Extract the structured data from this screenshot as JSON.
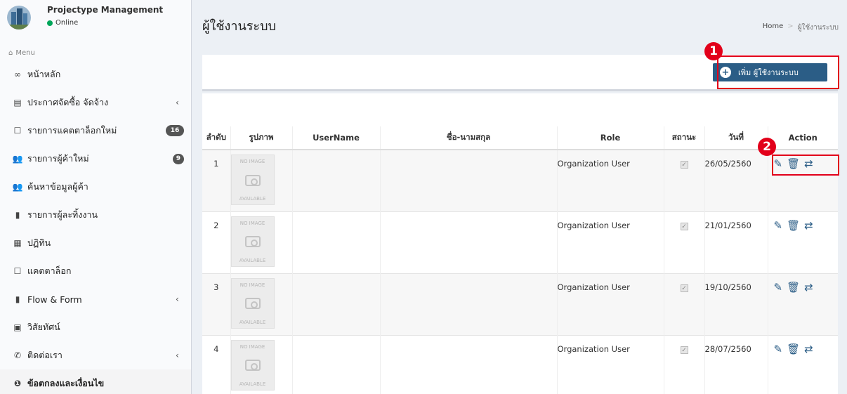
{
  "app": {
    "name": "Projectype Management",
    "status": "Online"
  },
  "sidebar": {
    "header": "Menu",
    "items": [
      {
        "icon": "link-icon",
        "glyph": "∞",
        "label": "หน้าหลัก"
      },
      {
        "icon": "newspaper-icon",
        "glyph": "▤",
        "label": "ประกาศจัดซื้อ จัดจ้าง",
        "chevron": "‹"
      },
      {
        "icon": "square-icon",
        "glyph": "☐",
        "label": "รายการแคตตาล็อกใหม่",
        "badge": "16"
      },
      {
        "icon": "users-icon",
        "glyph": "👥",
        "label": "รายการผู้ค้าใหม่",
        "badge": "9"
      },
      {
        "icon": "users-icon",
        "glyph": "👥",
        "label": "ค้นหาข้อมูลผู้ค้า"
      },
      {
        "icon": "file-icon",
        "glyph": "▮",
        "label": "รายการผู้ละทิ้งงาน"
      },
      {
        "icon": "calendar-icon",
        "glyph": "▦",
        "label": "ปฏิทิน"
      },
      {
        "icon": "square-icon",
        "glyph": "☐",
        "label": "แคตตาล็อก"
      },
      {
        "icon": "files-icon",
        "glyph": "▮",
        "label": "Flow & Form",
        "chevron": "‹"
      },
      {
        "icon": "image-icon",
        "glyph": "▣",
        "label": "วิสัยทัศน์"
      },
      {
        "icon": "whatsapp-icon",
        "glyph": "✆",
        "label": "ติดต่อเรา",
        "chevron": "‹"
      },
      {
        "icon": "info-icon",
        "glyph": "❶",
        "label": "ข้อตกลงและเงื่อนไข"
      }
    ]
  },
  "header": {
    "title": "ผู้ใช้งานระบบ",
    "breadcrumb_home": "Home",
    "breadcrumb_sep": ">",
    "breadcrumb_current": "ผู้ใช้งานระบบ"
  },
  "toolbar": {
    "add_label": "เพิ่ม ผู้ใช้งานระบบ",
    "add_icon": "+"
  },
  "markers": {
    "one": "1",
    "two": "2"
  },
  "table": {
    "headers": [
      "ลำดับ",
      "รูปภาพ",
      "UserName",
      "ชื่อ-นามสกุล",
      "Role",
      "สถานะ",
      "วันที่",
      "Action"
    ],
    "no_image_top": "NO IMAGE",
    "no_image_bottom": "AVAILABLE",
    "rows": [
      {
        "no": "1",
        "username": "",
        "fullname": "",
        "role": "Organization User",
        "status": "✓",
        "date": "26/05/2560"
      },
      {
        "no": "2",
        "username": "",
        "fullname": "",
        "role": "Organization User",
        "status": "✓",
        "date": "21/01/2560"
      },
      {
        "no": "3",
        "username": "",
        "fullname": "",
        "role": "Organization User",
        "status": "✓",
        "date": "19/10/2560"
      },
      {
        "no": "4",
        "username": "",
        "fullname": "",
        "role": "Organization User",
        "status": "✓",
        "date": "28/07/2560"
      }
    ]
  },
  "colors": {
    "accent": "#2b5d86",
    "marker": "#e2001a",
    "online": "#00a65a"
  }
}
